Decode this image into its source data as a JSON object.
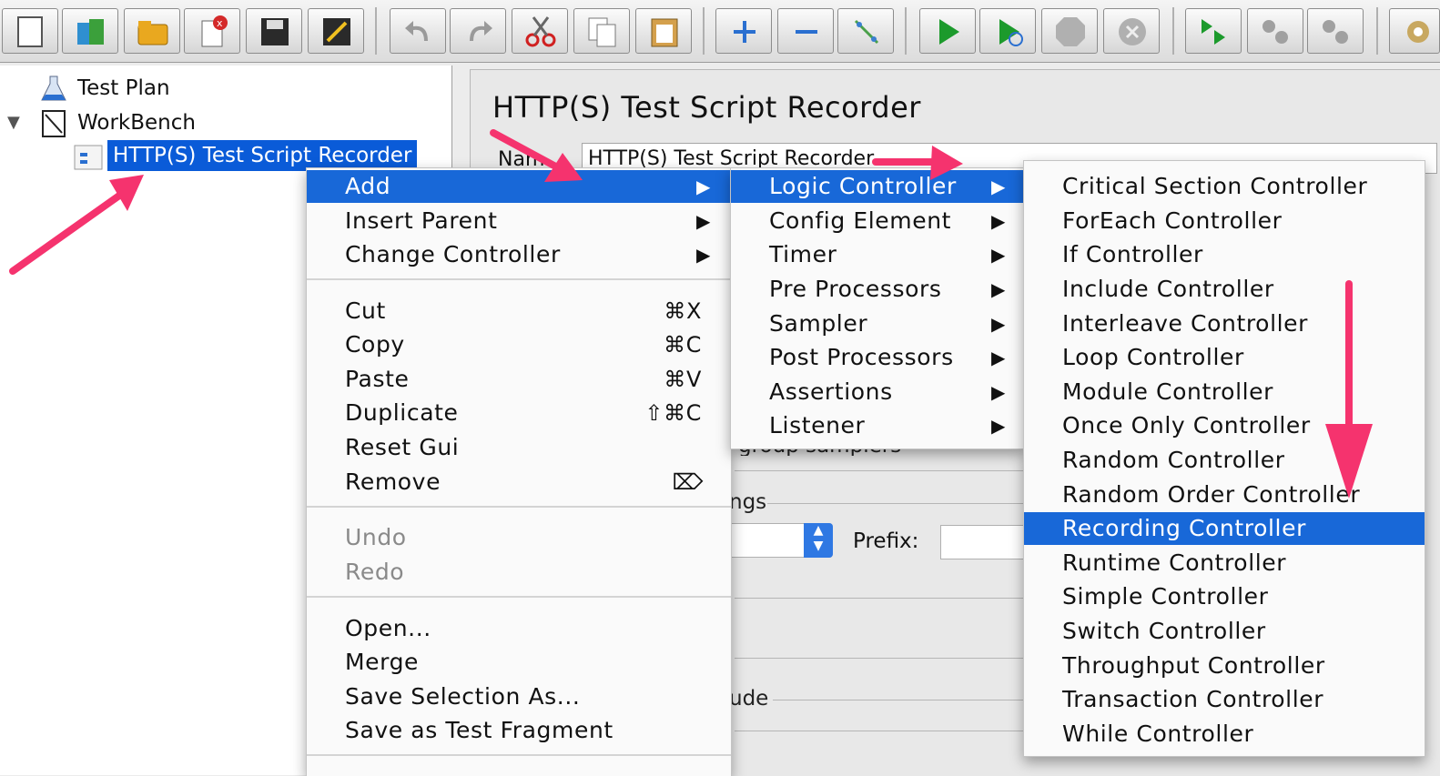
{
  "toolbar": {
    "buttons": [
      {
        "name": "new-icon"
      },
      {
        "name": "templates-icon"
      },
      {
        "name": "open-icon"
      },
      {
        "name": "close-icon"
      },
      {
        "name": "save-icon"
      },
      {
        "name": "save-screenshot-icon"
      },
      {
        "name": "undo-icon"
      },
      {
        "name": "redo-icon"
      },
      {
        "name": "cut-icon"
      },
      {
        "name": "copy-icon"
      },
      {
        "name": "paste-icon"
      },
      {
        "name": "expand-icon"
      },
      {
        "name": "collapse-icon"
      },
      {
        "name": "toggle-icon"
      },
      {
        "name": "start-icon"
      },
      {
        "name": "start-no-timers-icon"
      },
      {
        "name": "stop-icon"
      },
      {
        "name": "shutdown-icon"
      },
      {
        "name": "remote-start-icon"
      },
      {
        "name": "remote-stop-icon"
      },
      {
        "name": "remote-shutdown-icon"
      },
      {
        "name": "settings-icon"
      }
    ]
  },
  "tree": {
    "items": [
      {
        "label": "Test Plan"
      },
      {
        "label": "WorkBench"
      },
      {
        "label": "HTTP(S) Test Script Recorder"
      }
    ]
  },
  "panel": {
    "title": "HTTP(S) Test Script Recorder",
    "name_label": "Nam",
    "name_value": "HTTP(S) Test Script Recorder",
    "grouping_text": "group samplers",
    "settings_label": "ngs",
    "prefix_label": "Prefix:",
    "include_label": "ude"
  },
  "context_menu": {
    "items": [
      {
        "label": "Add",
        "submenu": "▶"
      },
      {
        "label": "Insert Parent",
        "submenu": "▶"
      },
      {
        "label": "Change Controller",
        "submenu": "▶"
      },
      {
        "label": "Cut",
        "shortcut": "⌘X"
      },
      {
        "label": "Copy",
        "shortcut": "⌘C"
      },
      {
        "label": "Paste",
        "shortcut": "⌘V"
      },
      {
        "label": "Duplicate",
        "shortcut": "⇧⌘C"
      },
      {
        "label": "Reset Gui",
        "shortcut": ""
      },
      {
        "label": "Remove",
        "shortcut": "⌦"
      },
      {
        "label": "Undo"
      },
      {
        "label": "Redo"
      },
      {
        "label": "Open..."
      },
      {
        "label": "Merge"
      },
      {
        "label": "Save Selection As..."
      },
      {
        "label": "Save as Test Fragment"
      }
    ]
  },
  "add_menu": {
    "items": [
      {
        "label": "Logic Controller",
        "submenu": "▶"
      },
      {
        "label": "Config Element",
        "submenu": "▶"
      },
      {
        "label": "Timer",
        "submenu": "▶"
      },
      {
        "label": "Pre Processors",
        "submenu": "▶"
      },
      {
        "label": "Sampler",
        "submenu": "▶"
      },
      {
        "label": "Post Processors",
        "submenu": "▶"
      },
      {
        "label": "Assertions",
        "submenu": "▶"
      },
      {
        "label": "Listener",
        "submenu": "▶"
      }
    ]
  },
  "logic_menu": {
    "items": [
      {
        "label": "Critical Section Controller"
      },
      {
        "label": "ForEach Controller"
      },
      {
        "label": "If Controller"
      },
      {
        "label": "Include Controller"
      },
      {
        "label": "Interleave Controller"
      },
      {
        "label": "Loop Controller"
      },
      {
        "label": "Module Controller"
      },
      {
        "label": "Once Only Controller"
      },
      {
        "label": "Random Controller"
      },
      {
        "label": "Random Order Controller"
      },
      {
        "label": "Recording Controller"
      },
      {
        "label": "Runtime Controller"
      },
      {
        "label": "Simple Controller"
      },
      {
        "label": "Switch Controller"
      },
      {
        "label": "Throughput Controller"
      },
      {
        "label": "Transaction Controller"
      },
      {
        "label": "While Controller"
      }
    ]
  },
  "colors": {
    "highlight": "#1868d8",
    "annotation_arrow": "#f5336e"
  }
}
